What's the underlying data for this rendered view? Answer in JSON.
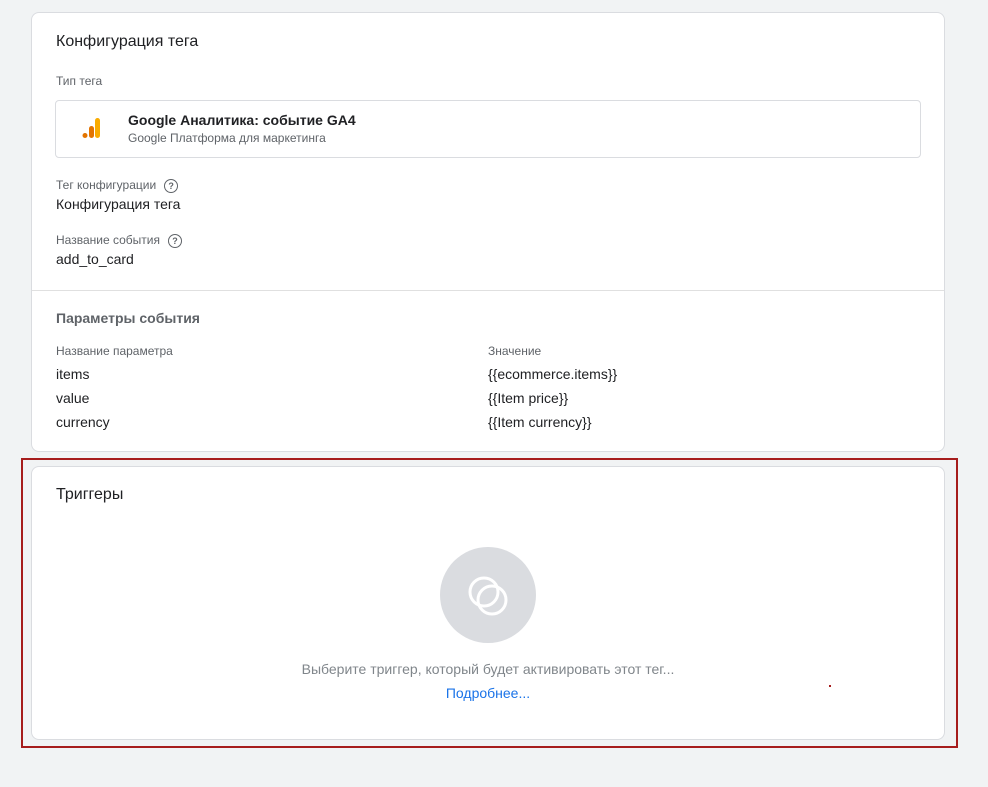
{
  "config_card": {
    "title": "Конфигурация тега",
    "tag_type_label": "Тип тега",
    "tag_type_name": "Google Аналитика: событие GA4",
    "tag_type_subtitle": "Google Платформа для маркетинга",
    "tag_type_icon": "google-analytics-icon",
    "config_tag_label": "Тег конфигурации",
    "config_tag_value": "Конфигурация тега",
    "event_name_label": "Название события",
    "event_name_value": "add_to_card",
    "help_icon_glyph": "?",
    "params_title": "Параметры события",
    "params_table": {
      "headers": [
        "Название параметра",
        "Значение"
      ],
      "rows": [
        {
          "name": "items",
          "value": "{{ecommerce.items}}"
        },
        {
          "name": "value",
          "value": "{{Item price}}"
        },
        {
          "name": "currency",
          "value": "{{Item currency}}"
        }
      ]
    }
  },
  "trigger_card": {
    "title": "Триггеры",
    "empty_icon": "trigger-circles-icon",
    "empty_message": "Выберите триггер, который будет активировать этот тег...",
    "learn_more_link": "Подробнее..."
  },
  "colors": {
    "background": "#f1f3f4",
    "card": "#ffffff",
    "ga_orange": "#f9ab00",
    "ga_dark_orange": "#e37400",
    "link_blue": "#1a73e8",
    "highlight_red": "#a61c1c"
  }
}
